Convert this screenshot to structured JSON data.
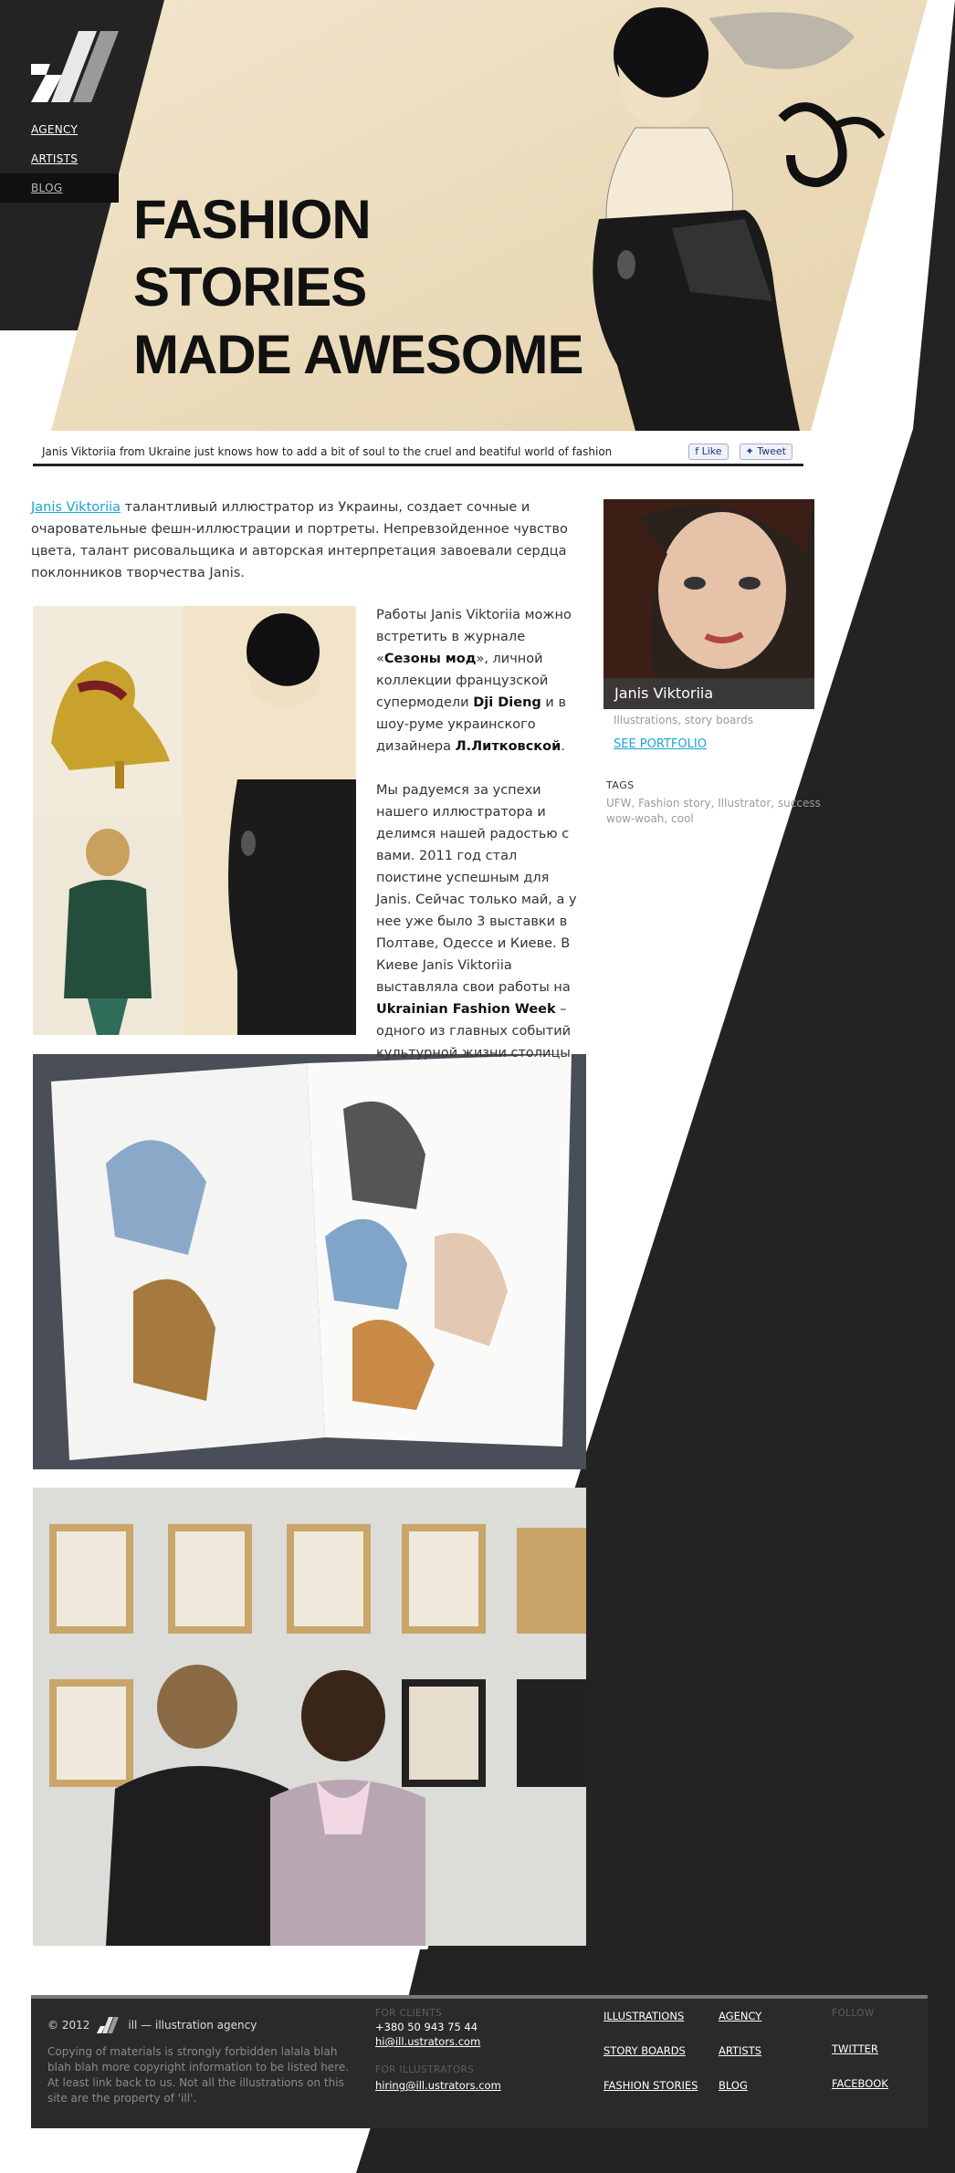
{
  "nav": {
    "items": [
      {
        "label": "AGENCY"
      },
      {
        "label": "ARTISTS"
      },
      {
        "label": "BLOG"
      }
    ]
  },
  "hero": {
    "title_lines": [
      "FASHION",
      "STORIES",
      "MADE AWESOME"
    ],
    "caption": "Janis Viktoriia from Ukraine just knows how to add a bit of soul to the cruel and beatiful world of fashion",
    "like_label": "Like",
    "tweet_label": "Tweet"
  },
  "article": {
    "intro_link": "Janis Viktoriia",
    "intro_text": " талантливый иллюстратор из Украины, создает сочные и очаровательные фешн-иллюстрации и портреты. Непревзойденное чувство цвета, талант рисовальщика и авторская интерпретация завоевали сердца поклонников творчества Janis.",
    "p1_a": "Работы Janis Viktoriia можно встретить в журнале «",
    "p1_b": "Сезоны мод",
    "p1_c": "», личной коллекции французской супермодели ",
    "p1_d": "Dji Dieng",
    "p1_e": " и в шоу-руме украинского дизайнера ",
    "p1_f": "Л.Литковской",
    "p1_g": ".",
    "p2_a": "Мы радуемся за успехи нашего иллюстратора и делимся нашей радостью с вами. 2011 год стал поистине успешным для Janis. Сейчас только май, а у нее уже было 3 выставки в Полтаве, Одессе и Киеве. В Киеве Janis Viktoriia выставляла свои работы на ",
    "p2_b": "Ukrainian Fashion Week",
    "p2_c": " – одного из главных событий культурной жизни столицы."
  },
  "artist": {
    "name": "Janis Viktoriia",
    "subtitle": "Illustrations, story boards",
    "portfolio_label": "SEE PORTFOLIO",
    "tags_title": "TAGS",
    "tags": "UFW, Fashion story, Illustrator, success wow-woah, cool"
  },
  "footer": {
    "copyright": "© 2012",
    "brand": "ill — illustration agency",
    "legal": "Copying of materials is strongly forbidden lalala blah blah blah more copyright information to be listed here. At least link back to us. Not all the illustrations on this site are the property of 'ill'.",
    "clients_label": "FOR CLIENTS",
    "clients_phone": "+380 50 943 75 44",
    "clients_email": "hi@ill.ustrators.com",
    "illustrators_label": "FOR ILLUSTRATORS",
    "illustrators_email": "hiring@ill.ustrators.com",
    "links_col1": [
      "ILLUSTRATIONS",
      "STORY BOARDS",
      "FASHION STORIES"
    ],
    "links_col2": [
      "AGENCY",
      "ARTISTS",
      "BLOG"
    ],
    "follow_label": "FOLLOW",
    "follow_links": [
      "TWITTER",
      "FACEBOOK"
    ]
  },
  "colors": {
    "dark": "#222222",
    "accent_link": "#1aa3d3",
    "hero_bg": "#efe2c6"
  }
}
